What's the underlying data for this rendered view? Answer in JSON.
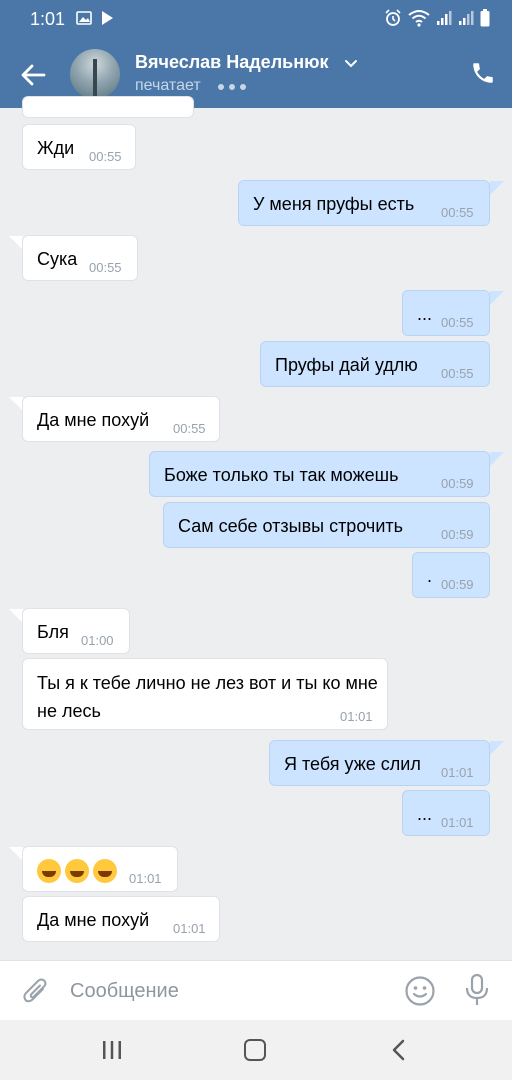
{
  "status_bar": {
    "time": "1:01"
  },
  "header": {
    "contact_name": "Вячеслав Надельнюк",
    "status": "печатает"
  },
  "messages": [
    {
      "dir": "in",
      "text": "Жди",
      "time": "00:55"
    },
    {
      "dir": "out",
      "text": "У меня пруфы есть",
      "time": "00:55"
    },
    {
      "dir": "in",
      "text": "Сука",
      "time": "00:55"
    },
    {
      "dir": "out",
      "text": "...",
      "time": "00:55"
    },
    {
      "dir": "out",
      "text": "Пруфы дай удлю",
      "time": "00:55"
    },
    {
      "dir": "in",
      "text": "Да мне похуй",
      "time": "00:55"
    },
    {
      "dir": "out",
      "text": "Боже только ты так можешь",
      "time": "00:59"
    },
    {
      "dir": "out",
      "text": "Сам себе отзывы строчить",
      "time": "00:59"
    },
    {
      "dir": "out",
      "text": ".",
      "time": "00:59"
    },
    {
      "dir": "in",
      "text": "Бля",
      "time": "01:00"
    },
    {
      "dir": "in",
      "text": "Ты я к тебе лично не лез вот и ты ко мне не лесь",
      "time": "01:01"
    },
    {
      "dir": "out",
      "text": "Я тебя уже слил",
      "time": "01:01"
    },
    {
      "dir": "out",
      "text": "...",
      "time": "01:01"
    },
    {
      "dir": "in",
      "text": "",
      "emoji": [
        "rolling-on-floor-laughing",
        "rolling-on-floor-laughing",
        "rolling-on-floor-laughing"
      ],
      "time": "01:01"
    },
    {
      "dir": "in",
      "text": "Да мне похуй",
      "time": "01:01"
    }
  ],
  "composer": {
    "placeholder": "Сообщение"
  },
  "colors": {
    "header": "#4a76a8",
    "outgoing_bubble": "#cce4ff",
    "incoming_bubble": "#ffffff",
    "background": "#edeef0"
  }
}
